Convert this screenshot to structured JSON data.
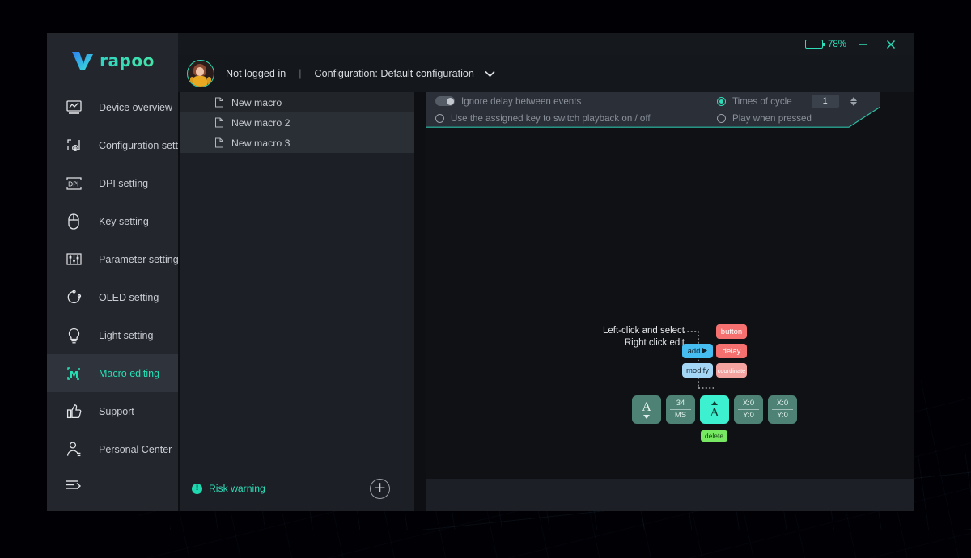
{
  "brand": {
    "name": "rapoo",
    "accent": "#2fdcb8",
    "logo_icon": "v-checkmark-logo"
  },
  "titlebar": {
    "battery_percent": "78%",
    "battery_level": 78,
    "battery_icon": "battery-icon",
    "minimize_label": "—",
    "close_label": "✕"
  },
  "account": {
    "avatar_icon": "user-avatar",
    "status": "Not logged in",
    "separator": "|",
    "configuration": "Configuration: Default configuration",
    "dropdown_icon": "chevron-down-icon"
  },
  "sidebar": {
    "items": [
      {
        "label": "Device overview",
        "icon": "device-overview-icon",
        "active": false
      },
      {
        "label": "Configuration setting",
        "icon": "configuration-setting-icon",
        "active": false
      },
      {
        "label": "DPI setting",
        "icon": "dpi-setting-icon",
        "active": false
      },
      {
        "label": "Key setting",
        "icon": "mouse-key-icon",
        "active": false
      },
      {
        "label": "Parameter setting",
        "icon": "sliders-icon",
        "active": false
      },
      {
        "label": "OLED setting",
        "icon": "refresh-circle-icon",
        "active": false
      },
      {
        "label": "Light setting",
        "icon": "lightbulb-icon",
        "active": false
      },
      {
        "label": "Macro editing",
        "icon": "macro-editing-icon",
        "active": true
      },
      {
        "label": "Support",
        "icon": "thumbs-up-icon",
        "active": false
      },
      {
        "label": "Personal Center",
        "icon": "person-icon",
        "active": false
      }
    ],
    "collapse_icon": "collapse-menu-icon"
  },
  "macro_list": {
    "items": [
      {
        "label": "New macro",
        "icon": "file-icon"
      },
      {
        "label": "New macro 2",
        "icon": "file-icon"
      },
      {
        "label": "New macro 3",
        "icon": "file-icon"
      }
    ],
    "risk_warning": "Risk warning",
    "risk_icon": "info-icon",
    "add_button_icon": "plus-circle-icon",
    "add_button_label": "+"
  },
  "options": {
    "ignore_delay": {
      "label": "Ignore delay between events",
      "control": "toggle",
      "on": false
    },
    "switch_playback": {
      "label": "Use the assigned key to switch playback on / off",
      "control": "radio",
      "selected": false
    },
    "times_of_cycle": {
      "label": "Times of cycle",
      "control": "radio",
      "selected": true,
      "value": "1",
      "spinner_icon": "spinner-arrows-icon"
    },
    "play_when_pressed": {
      "label": "Play when pressed",
      "control": "radio",
      "selected": false
    }
  },
  "diagram": {
    "hint_line1": "Left-click and select",
    "hint_line2": "Right click edit",
    "context_menu": [
      {
        "label": "add",
        "icon": "arrow-right-icon",
        "kind": "primary"
      },
      {
        "label": "modify",
        "kind": "secondary"
      }
    ],
    "submenu": [
      {
        "label": "button"
      },
      {
        "label": "delay"
      },
      {
        "label": "coordinate"
      }
    ],
    "delete_label": "delete",
    "events": [
      {
        "type": "key",
        "big": "A",
        "arrow": "down",
        "selected": false
      },
      {
        "type": "delay",
        "line1": "34",
        "line2": "MS",
        "selected": false
      },
      {
        "type": "key",
        "big": "A",
        "arrow": "up",
        "selected": true
      },
      {
        "type": "coordinate",
        "line1": "X:0",
        "line2": "Y:0",
        "selected": false
      },
      {
        "type": "coordinate",
        "line1": "X:0",
        "line2": "Y:0",
        "selected": false
      }
    ]
  }
}
